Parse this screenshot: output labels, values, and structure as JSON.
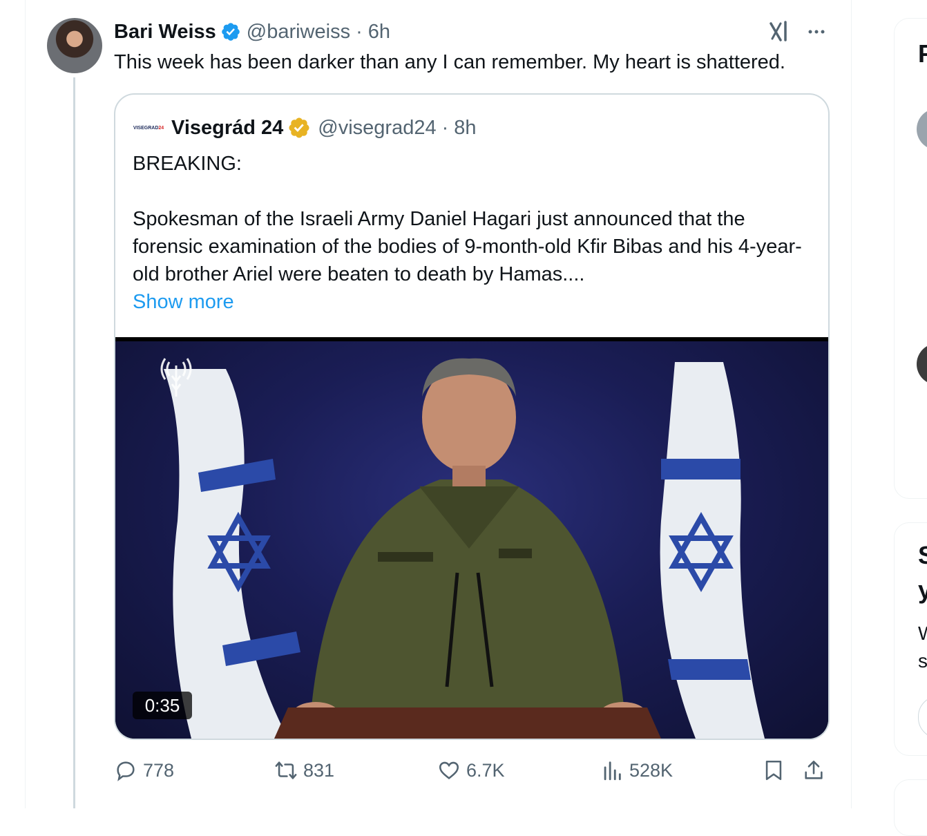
{
  "tweet": {
    "author_name": "Bari Weiss",
    "handle": "@bariweiss",
    "separator": "·",
    "time": "6h",
    "text": "This week has been darker than any I can remember. My heart is shattered."
  },
  "quoted_tweet": {
    "author_name": "Visegrád 24",
    "handle": "@visegrad24",
    "separator": "·",
    "time": "8h",
    "avatar_text_main": "VISEGRAD",
    "avatar_text_accent": "24",
    "line1": "BREAKING:",
    "paragraph": "Spokesman of the Israeli Army Daniel Hagari just announced that the forensic examination of the bodies of 9-month-old Kfir Bibas and his 4-year-old brother Ariel were beaten to death by Hamas....",
    "show_more": "Show more",
    "video_duration": "0:35"
  },
  "actions": {
    "replies": "778",
    "reposts": "831",
    "likes": "6.7K",
    "views": "528K"
  },
  "right_sidebar": {
    "card1_title_fragment": "F",
    "card2_title_line1": "S",
    "card2_title_line2": "y",
    "card2_body_line1": "W",
    "card2_body_line2": "s"
  },
  "colors": {
    "accent_blue": "#1d9bf0",
    "muted_text": "#536471",
    "gold_verified": "#e8b323",
    "border": "#cfd9de"
  },
  "icons": [
    "verified-badge-icon",
    "gold-verified-badge-icon",
    "grok-icon",
    "more-icon",
    "reply-icon",
    "repost-icon",
    "like-icon",
    "views-icon",
    "bookmark-icon",
    "share-icon"
  ]
}
